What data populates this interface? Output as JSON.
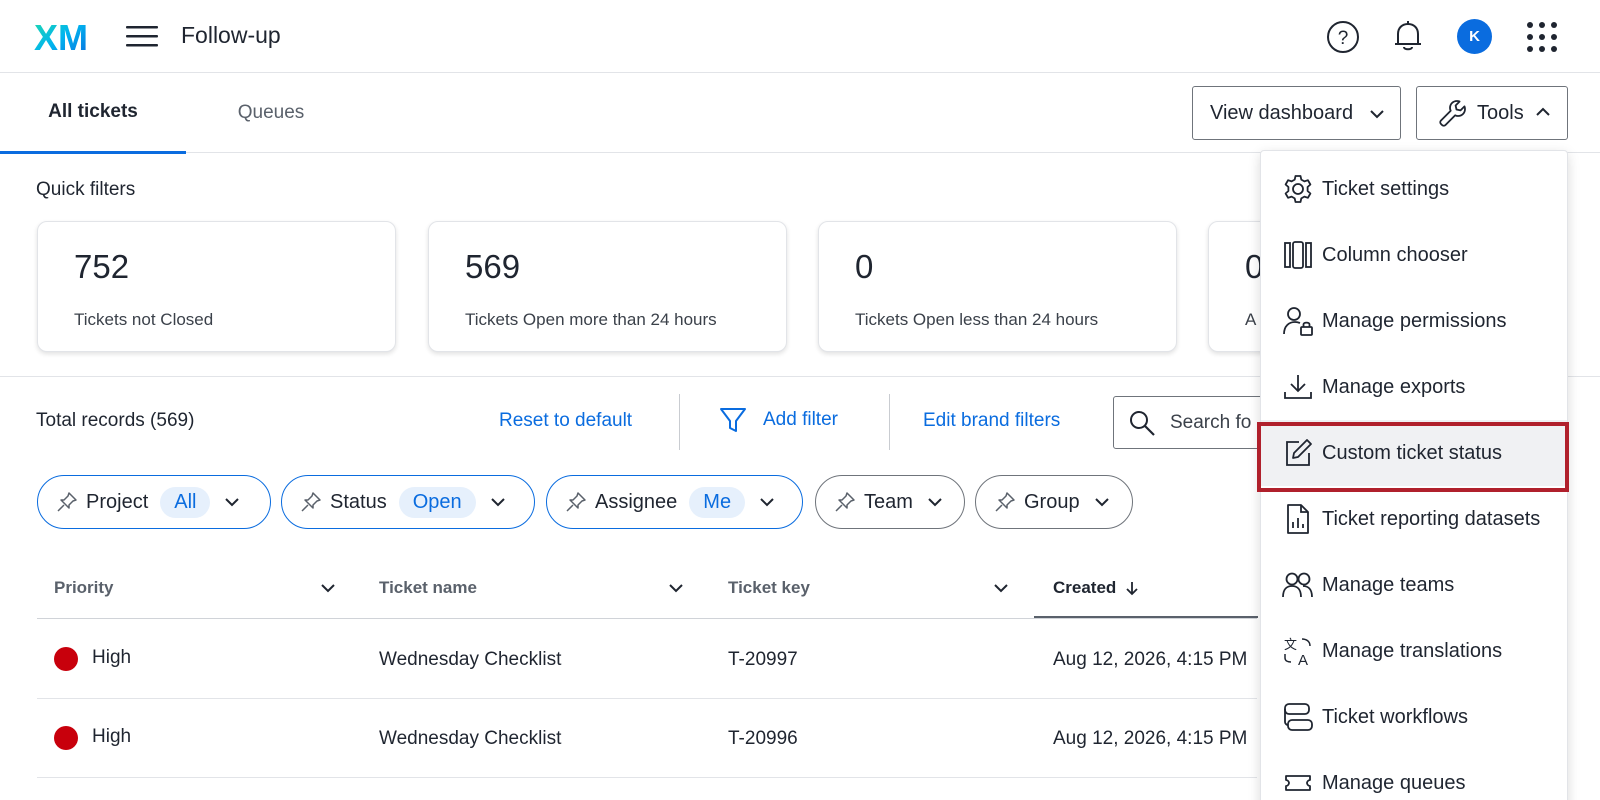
{
  "app": {
    "logo_text": "XM",
    "title": "Follow-up",
    "avatar_initial": "K",
    "brand_color": "#0a6cdf"
  },
  "header_icons": [
    "menu-icon",
    "help-icon",
    "bell-icon",
    "apps-grid-icon"
  ],
  "tabs": [
    {
      "label": "All tickets",
      "active": true
    },
    {
      "label": "Queues",
      "active": false
    }
  ],
  "toolbar_buttons": {
    "view_dashboard": "View dashboard",
    "tools": "Tools"
  },
  "quick_filters": {
    "label": "Quick filters",
    "cards": [
      {
        "value": "752",
        "label": "Tickets not Closed"
      },
      {
        "value": "569",
        "label": "Tickets Open more than 24 hours"
      },
      {
        "value": "0",
        "label": "Tickets Open less than 24 hours"
      },
      {
        "value": "0",
        "label": "A"
      }
    ]
  },
  "records": {
    "total": "Total records (569)",
    "reset": "Reset to default",
    "add_filter": "Add filter",
    "edit_brand": "Edit brand filters",
    "search_placeholder": "Search fo"
  },
  "filter_chips": [
    {
      "label": "Project",
      "value": "All",
      "active": true
    },
    {
      "label": "Status",
      "value": "Open",
      "active": true
    },
    {
      "label": "Assignee",
      "value": "Me",
      "active": true
    },
    {
      "label": "Team",
      "value": "",
      "active": false
    },
    {
      "label": "Group",
      "value": "",
      "active": false
    }
  ],
  "table": {
    "columns": [
      "Priority",
      "Ticket name",
      "Ticket key",
      "Created"
    ],
    "sorted_column": "Created",
    "sort_direction": "descending",
    "rows": [
      {
        "priority": "High",
        "priority_color": "#c8000c",
        "name": "Wednesday Checklist",
        "key": "T-20997",
        "created": "Aug 12, 2026, 4:15 PM"
      },
      {
        "priority": "High",
        "priority_color": "#c8000c",
        "name": "Wednesday Checklist",
        "key": "T-20996",
        "created": "Aug 12, 2026, 4:15 PM"
      }
    ]
  },
  "tools_menu": {
    "items": [
      {
        "label": "Ticket settings",
        "icon": "gear-icon"
      },
      {
        "label": "Column chooser",
        "icon": "columns-icon"
      },
      {
        "label": "Manage permissions",
        "icon": "user-lock-icon"
      },
      {
        "label": "Manage exports",
        "icon": "download-icon"
      },
      {
        "label": "Custom ticket status",
        "icon": "edit-icon",
        "highlighted": true
      },
      {
        "label": "Ticket reporting datasets",
        "icon": "report-file-icon"
      },
      {
        "label": "Manage teams",
        "icon": "team-icon"
      },
      {
        "label": "Manage translations",
        "icon": "translate-icon"
      },
      {
        "label": "Ticket workflows",
        "icon": "workflow-icon"
      },
      {
        "label": "Manage queues",
        "icon": "queue-icon"
      }
    ],
    "highlight_color": "#b0202c"
  }
}
